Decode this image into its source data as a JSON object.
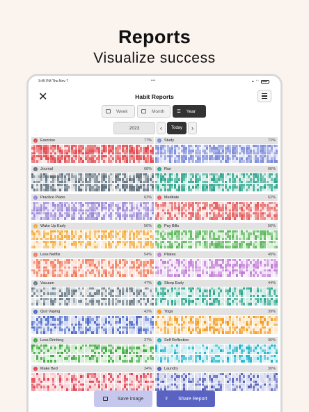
{
  "hero": {
    "title": "Reports",
    "subtitle": "Visualize success"
  },
  "status_bar": {
    "time": "3:45 PM   Thu Nov 7"
  },
  "header": {
    "title": "Habit Reports",
    "close_icon": "close-icon",
    "menu_icon": "hamburger-icon"
  },
  "tabs": [
    {
      "label": "Week",
      "active": false
    },
    {
      "label": "Month",
      "active": false
    },
    {
      "label": "Year",
      "active": true
    }
  ],
  "year_nav": {
    "year": "2023",
    "prev": "‹",
    "today": "Today",
    "next": "›"
  },
  "habits": [
    {
      "name": "Exercise",
      "percent": "77%",
      "color": "#e0474c",
      "value": 0.77
    },
    {
      "name": "Study",
      "percent": "72%",
      "color": "#7b8ad8",
      "value": 0.72
    },
    {
      "name": "Journal",
      "percent": "68%",
      "color": "#5e6e7a",
      "value": 0.68
    },
    {
      "name": "Run",
      "percent": "66%",
      "color": "#2aa38a",
      "value": 0.66
    },
    {
      "name": "Practice Piano",
      "percent": "63%",
      "color": "#9a86d6",
      "value": 0.63
    },
    {
      "name": "Meditate",
      "percent": "62%",
      "color": "#e45a5a",
      "value": 0.62
    },
    {
      "name": "Wake Up Early",
      "percent": "56%",
      "color": "#f3a93a",
      "value": 0.56
    },
    {
      "name": "Pay Bills",
      "percent": "56%",
      "color": "#5cb85c",
      "value": 0.56
    },
    {
      "name": "Less Netflix",
      "percent": "54%",
      "color": "#f07a5a",
      "value": 0.54
    },
    {
      "name": "Pilates",
      "percent": "49%",
      "color": "#c07ad6",
      "value": 0.49
    },
    {
      "name": "Vacuum",
      "percent": "47%",
      "color": "#6a7a86",
      "value": 0.47
    },
    {
      "name": "Sleep Early",
      "percent": "44%",
      "color": "#2aa38a",
      "value": 0.44
    },
    {
      "name": "Quit Vaping",
      "percent": "42%",
      "color": "#4a68c8",
      "value": 0.42
    },
    {
      "name": "Yoga",
      "percent": "39%",
      "color": "#f39a1a",
      "value": 0.39
    },
    {
      "name": "Less Drinking",
      "percent": "37%",
      "color": "#3aa83a",
      "value": 0.37
    },
    {
      "name": "Self Reflection",
      "percent": "36%",
      "color": "#18b0c8",
      "value": 0.36
    },
    {
      "name": "Make Bed",
      "percent": "34%",
      "color": "#e04050",
      "value": 0.34
    },
    {
      "name": "Laundry",
      "percent": "30%",
      "color": "#4a58b8",
      "value": 0.3
    }
  ],
  "actions": {
    "save": "Save Image",
    "share": "Share Report",
    "save_icon": "image-icon",
    "share_icon": "share-icon"
  }
}
